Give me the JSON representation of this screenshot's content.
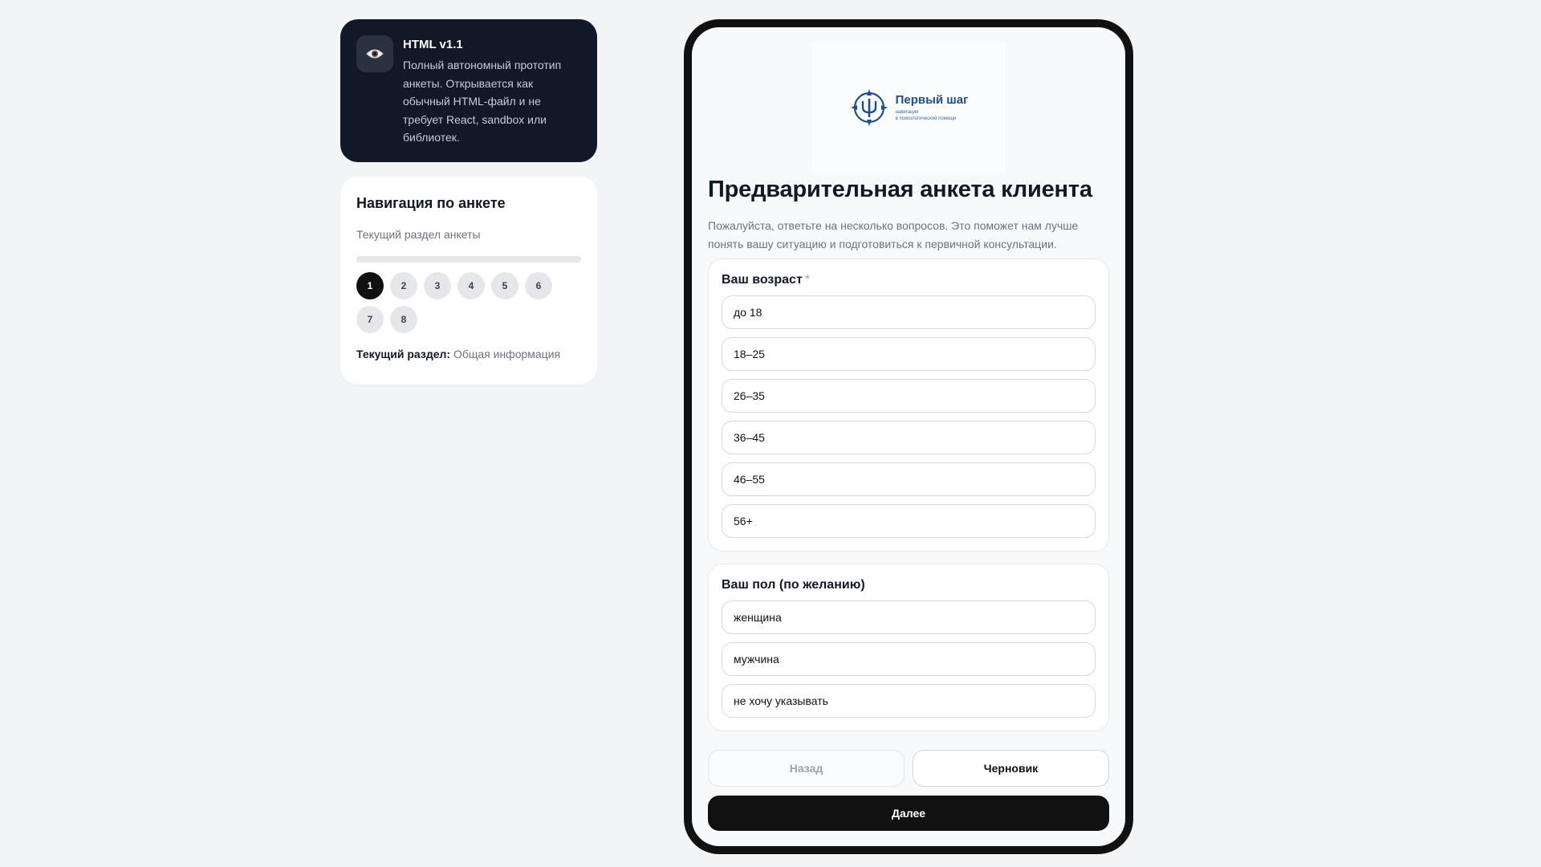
{
  "info_card": {
    "icon": "eye-icon",
    "title": "HTML v1.1",
    "description": "Полный автономный прототип анкеты. Открывается как обычный HTML-файл и не требует React, sandbox или библиотек."
  },
  "nav_card": {
    "title": "Навигация по анкете",
    "subtitle": "Текущий раздел анкеты",
    "progress_fraction": 0.0,
    "steps": [
      "1",
      "2",
      "3",
      "4",
      "5",
      "6",
      "7",
      "8"
    ],
    "active_step": "1",
    "current_label": "Текущий раздел:",
    "current_value": "Общая информация"
  },
  "form": {
    "logo": {
      "name": "Первый шаг",
      "tagline_1": "навигация",
      "tagline_2": "в психологической помощи",
      "color": "#1f4f8b"
    },
    "title": "Предварительная анкета клиента",
    "intro": "Пожалуйста, ответьте на несколько вопросов. Это поможет нам лучше понять вашу ситуацию и подготовиться к первичной консультации.",
    "questions": [
      {
        "label": "Ваш возраст",
        "required_mark": "*",
        "options": [
          "до 18",
          "18–25",
          "26–35",
          "36–45",
          "46–55",
          "56+"
        ]
      },
      {
        "label": "Ваш пол (по желанию)",
        "options": [
          "женщина",
          "мужчина",
          "не хочу указывать"
        ]
      }
    ],
    "buttons": {
      "back": "Назад",
      "draft": "Черновик",
      "next": "Далее"
    }
  }
}
